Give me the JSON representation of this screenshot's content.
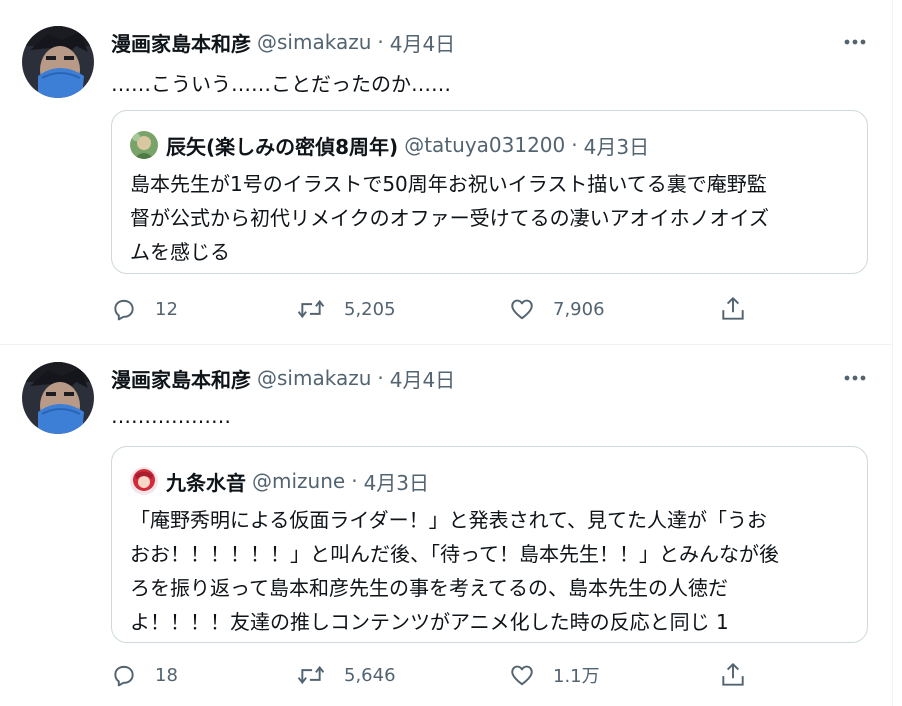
{
  "tweets": [
    {
      "author": {
        "name": "漫画家島本和彦",
        "handle": "@simakazu"
      },
      "date": "4月4日",
      "text": "……こういう……ことだったのか……",
      "quote": {
        "author": {
          "name": "辰矢(楽しみの密偵8周年)",
          "handle": "@tatuya031200"
        },
        "date": "4月3日",
        "lines": [
          "島本先生が1号のイラストで50周年お祝いイラスト描いてる裏で庵野監",
          "督が公式から初代リメイクのオファー受けてるの凄いアオイホノオイズ",
          "ムを感じる"
        ]
      },
      "stats": {
        "replies": "12",
        "retweets": "5,205",
        "likes": "7,906"
      }
    },
    {
      "author": {
        "name": "漫画家島本和彦",
        "handle": "@simakazu"
      },
      "date": "4月4日",
      "text": "………………",
      "quote": {
        "author": {
          "name": "九条水音",
          "handle": "@mizune"
        },
        "date": "4月3日",
        "lines": [
          "「庵野秀明による仮面ライダー！」と発表されて、見てた人達が「うお",
          "おお！！！！！！」と叫んだ後、「待って！島本先生！！」とみんなが後",
          "ろを振り返って島本和彦先生の事を考えてるの、島本先生の人徳だ",
          "よ！！！！友達の推しコンテンツがアニメ化した時の反応と同じ 1"
        ]
      },
      "stats": {
        "replies": "18",
        "retweets": "5,646",
        "likes": "1.1万"
      }
    }
  ],
  "icons": {
    "more": "more-icon",
    "reply": "reply-icon",
    "retweet": "retweet-icon",
    "like": "heart-icon",
    "share": "share-icon"
  },
  "colors": {
    "text": "#0f1419",
    "secondary": "#536471",
    "border": "#cfd9de",
    "divider": "#eff3f4"
  }
}
